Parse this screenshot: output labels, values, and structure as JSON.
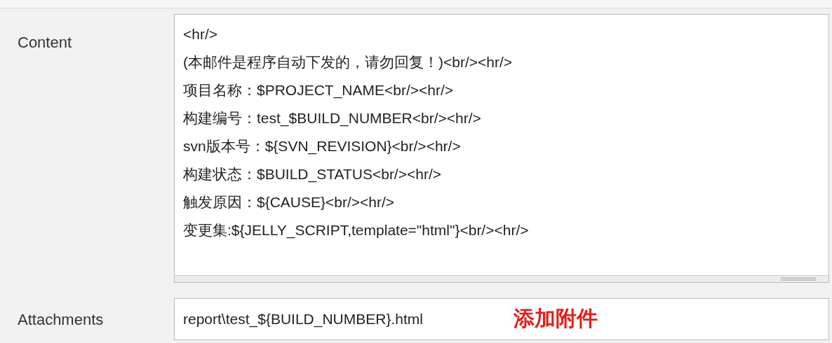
{
  "content": {
    "label": "Content",
    "lines": [
      "<hr/>",
      "(本邮件是程序自动下发的，请勿回复！)<br/><hr/>",
      "项目名称：$PROJECT_NAME<br/><hr/>",
      "构建编号：test_$BUILD_NUMBER<br/><hr/>",
      "svn版本号：${SVN_REVISION}<br/><hr/>",
      "构建状态：$BUILD_STATUS<br/><hr/>",
      "触发原因：${CAUSE}<br/><hr/>",
      "变更集:${JELLY_SCRIPT,template=\"html\"}<br/><hr/>"
    ]
  },
  "attachments": {
    "label": "Attachments",
    "value": "report\\test_${BUILD_NUMBER}.html",
    "annotation": "添加附件"
  }
}
